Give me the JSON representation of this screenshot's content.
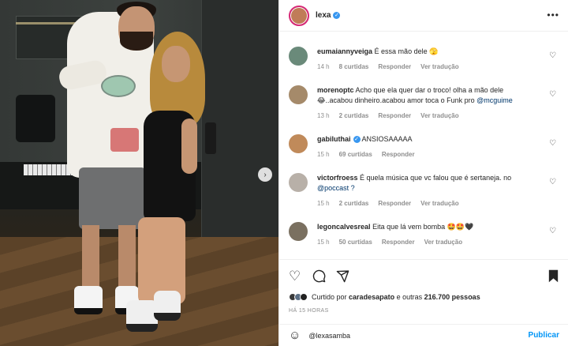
{
  "post": {
    "username": "lexa",
    "more_label": "•••"
  },
  "comments": [
    {
      "user": "eumaiannyveiga",
      "text": "É essa mão dele 🫣",
      "mention": "",
      "time": "14 h",
      "likes": "8 curtidas",
      "reply": "Responder",
      "translate": "Ver tradução",
      "avatar_color": "#6a8a7a"
    },
    {
      "user": "morenoptc",
      "text": "Acho que ela quer dar o troco! olha a mão dele 😂..acabou dinheiro.acabou amor toca o Funk pro",
      "mention": "@mcguime",
      "time": "13 h",
      "likes": "2 curtidas",
      "reply": "Responder",
      "translate": "Ver tradução",
      "avatar_color": "#a58a6a"
    },
    {
      "user": "gabiluthai",
      "text": "ANSIOSAAAAA",
      "mention": "",
      "time": "15 h",
      "likes": "69 curtidas",
      "reply": "Responder",
      "translate": "",
      "avatar_color": "#c08a5a"
    },
    {
      "user": "victorfroess",
      "text": "É quela música que vc falou que é sertaneja. no",
      "mention": "@poccast ?",
      "time": "15 h",
      "likes": "2 curtidas",
      "reply": "Responder",
      "translate": "Ver tradução",
      "avatar_color": "#b8b0a8"
    },
    {
      "user": "legoncalvesreal",
      "text": "Eita que lá vem bomba 🤩🤩🖤",
      "mention": "",
      "time": "15 h",
      "likes": "50 curtidas",
      "reply": "Responder",
      "translate": "Ver tradução",
      "avatar_color": "#7a7060"
    }
  ],
  "liked_by": {
    "prefix": "Curtido por",
    "user": "caradesapato",
    "suffix": "e outras",
    "count": "216.700 pessoas"
  },
  "timestamp": "HÁ 15 HORAS",
  "composer": {
    "value": "@lexasamba",
    "publish_label": "Publicar"
  },
  "icons": {
    "heart": "♡",
    "comment": "◯",
    "share": "➤",
    "save": "▮",
    "emoji": "☺",
    "next": "›",
    "verified": "✓"
  },
  "colors": {
    "accent": "#0095f6",
    "verified": "#3897f0",
    "meta_gray": "#8e8e8e"
  }
}
